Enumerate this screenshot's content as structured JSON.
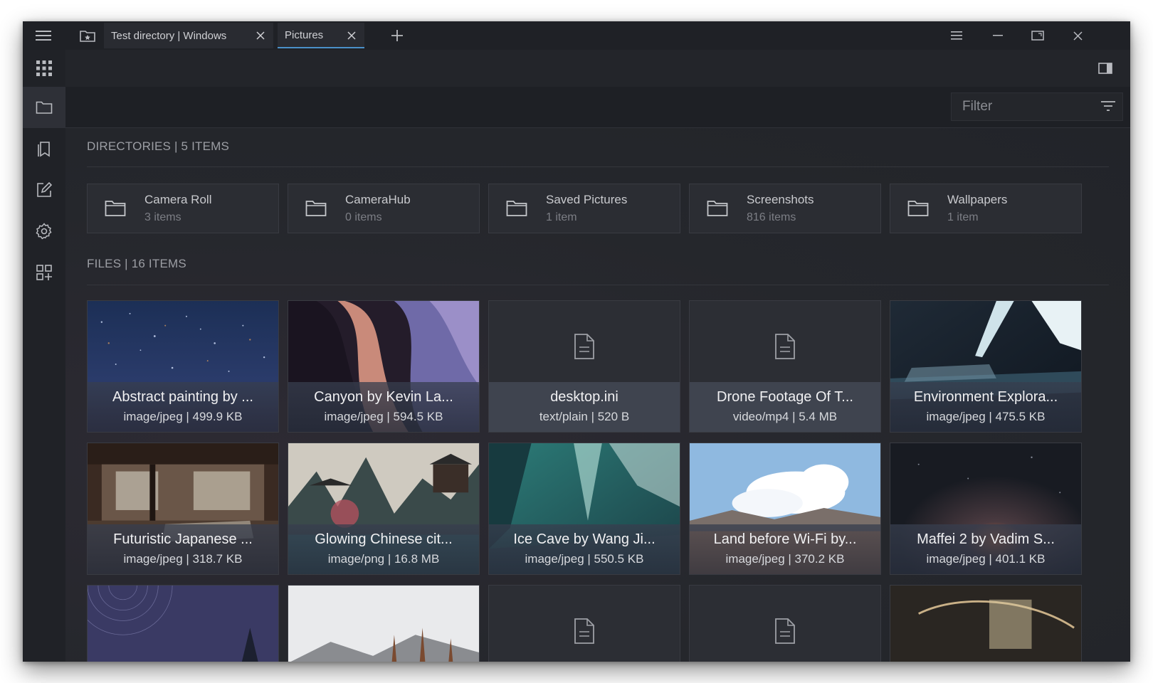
{
  "titlebar": {
    "tabs": [
      {
        "label": "Test directory | Windows"
      },
      {
        "label": "Pictures"
      }
    ]
  },
  "filter": {
    "placeholder": "Filter"
  },
  "directories": {
    "header": "DIRECTORIES | 5 ITEMS",
    "items": [
      {
        "name": "Camera Roll",
        "count": "3 items"
      },
      {
        "name": "CameraHub",
        "count": "0 items"
      },
      {
        "name": "Saved Pictures",
        "count": "1 item"
      },
      {
        "name": "Screenshots",
        "count": "816 items"
      },
      {
        "name": "Wallpapers",
        "count": "1 item"
      }
    ]
  },
  "files": {
    "header": "FILES | 16 ITEMS",
    "items": [
      {
        "name": "Abstract painting by ...",
        "meta": "image/jpeg | 499.9 KB",
        "thumb": "thumb-stars"
      },
      {
        "name": "Canyon by Kevin La...",
        "meta": "image/jpeg | 594.5 KB",
        "thumb": "thumb-canyon"
      },
      {
        "name": "desktop.ini",
        "meta": "text/plain | 520 B",
        "thumb": "doc"
      },
      {
        "name": "Drone Footage Of T...",
        "meta": "video/mp4 | 5.4 MB",
        "thumb": "doc"
      },
      {
        "name": "Environment Explora...",
        "meta": "image/jpeg | 475.5 KB",
        "thumb": "thumb-ice"
      },
      {
        "name": "Futuristic Japanese ...",
        "meta": "image/jpeg | 318.7 KB",
        "thumb": "thumb-japanese"
      },
      {
        "name": "Glowing Chinese cit...",
        "meta": "image/png | 16.8 MB",
        "thumb": "thumb-chinese"
      },
      {
        "name": "Ice Cave by Wang Ji...",
        "meta": "image/jpeg | 550.5 KB",
        "thumb": "thumb-cave"
      },
      {
        "name": "Land before Wi-Fi by...",
        "meta": "image/jpeg | 370.2 KB",
        "thumb": "thumb-land"
      },
      {
        "name": "Maffei 2 by Vadim S...",
        "meta": "image/jpeg | 401.1 KB",
        "thumb": "thumb-maffei"
      }
    ]
  }
}
